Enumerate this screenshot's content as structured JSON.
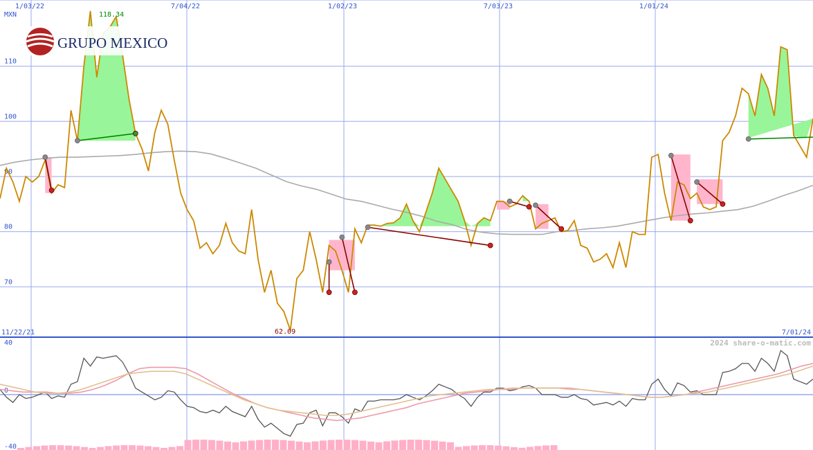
{
  "logo": {
    "text": "GRUPO MEXICO"
  },
  "watermark": "2024 share-o-matic.com",
  "chart_data": [
    {
      "type": "line",
      "title": "",
      "ylabel": "MXN",
      "x_tick_labels": [
        "1/03/22",
        "7/04/22",
        "1/02/23",
        "7/03/23",
        "1/01/24"
      ],
      "y_ticks": [
        70,
        80,
        90,
        100,
        110
      ],
      "ylim": [
        61,
        122
      ],
      "grid": true,
      "annotations": {
        "high": "118.34",
        "low": "62.09"
      },
      "series": [
        {
          "role": "price",
          "color": "#cc8800",
          "values": [
            86,
            91.5,
            89,
            85.5,
            90,
            89,
            90,
            93,
            87,
            88.5,
            88,
            102,
            96.5,
            110,
            120,
            108,
            116,
            117,
            119,
            112,
            104,
            97.8,
            95,
            91,
            98,
            102,
            99.5,
            93,
            87,
            84,
            82,
            77,
            78,
            76,
            77.5,
            81.5,
            78,
            76.5,
            76,
            84,
            75,
            69,
            73,
            67,
            65.5,
            62.09,
            71.5,
            73,
            80,
            75,
            69,
            77.5,
            76.5,
            73,
            69,
            80.5,
            78,
            81.2,
            81.2,
            81,
            81.5,
            81.6,
            82.5,
            85,
            82,
            80,
            83.5,
            87,
            91.5,
            89.5,
            87.5,
            85.5,
            82,
            77.5,
            81.5,
            82.5,
            82,
            85.5,
            85.5,
            84.5,
            85,
            86.5,
            85.5,
            80.5,
            81.5,
            82,
            82.5,
            80,
            80.2,
            82,
            77.5,
            77,
            74.5,
            75,
            76,
            73.5,
            78,
            73.5,
            80,
            79.5,
            79.5,
            93.5,
            94,
            87,
            82,
            89,
            88.5,
            86,
            87,
            84.5,
            84,
            84.5,
            96.5,
            98,
            101,
            106,
            105,
            101,
            108.5,
            106,
            101,
            113.5,
            113,
            97.5,
            95.5,
            93.5,
            100.5
          ]
        },
        {
          "role": "moving-average",
          "color": "#aaaaaa",
          "values": [
            92,
            92.6,
            93,
            93.3,
            93.5,
            93.5,
            93.6,
            93.7,
            93.8,
            94,
            94.3,
            94.5,
            94.6,
            94.5,
            94.1,
            93.3,
            92.4,
            91.5,
            90.3,
            89.1,
            88.3,
            87.7,
            86.8,
            85.9,
            85.5,
            84.8,
            84.1,
            83.5,
            82.8,
            81.9,
            81.3,
            80.4,
            79.9,
            79.6,
            79.5,
            79.5,
            79.5,
            80,
            80.2,
            80.5,
            80.7,
            81,
            81.5,
            82,
            82.5,
            82.9,
            83.2,
            83.4,
            83.7,
            84,
            84.6,
            85.5,
            86.5,
            87.4,
            88.4
          ]
        }
      ]
    },
    {
      "type": "line",
      "title": "",
      "x_tick_labels": [
        "11/22/21",
        "7/01/24"
      ],
      "y_ticks": [
        40,
        0,
        -40
      ],
      "ylim": [
        -40,
        40
      ],
      "grid": true,
      "series": [
        {
          "role": "oscillator",
          "color": "#555555",
          "values": [
            4,
            -2,
            -6,
            0,
            -3,
            -2,
            0,
            2,
            -3,
            -1,
            -2,
            8,
            10,
            28,
            22,
            29,
            28,
            29,
            30,
            25,
            16,
            5,
            2,
            -1,
            -4,
            -2,
            3,
            2,
            -4,
            -9,
            -10,
            -13,
            -14,
            -12,
            -14,
            -9,
            -13,
            -15,
            -17,
            -9,
            -19,
            -25,
            -22,
            -26,
            -30,
            -32,
            -23,
            -22,
            -14,
            -12,
            -24,
            -14,
            -14,
            -17,
            -22,
            -11,
            -13,
            -5,
            -5,
            -4,
            -4,
            -4,
            -3,
            0,
            -2,
            -4,
            -1,
            3,
            8,
            6,
            4,
            0,
            -3,
            -9,
            -2,
            2,
            2,
            5,
            5,
            3,
            4,
            6,
            7,
            5,
            0,
            0,
            0,
            -2,
            -2,
            0,
            -3,
            -4,
            -8,
            -7,
            -6,
            -8,
            -5,
            -9,
            -3,
            -4,
            -4,
            8,
            12,
            4,
            -1,
            9,
            7,
            2,
            3,
            0,
            0,
            0,
            17,
            18,
            20,
            24,
            24,
            18,
            28,
            24,
            18,
            34,
            30,
            12,
            10,
            8,
            12
          ]
        },
        {
          "role": "signal-fast",
          "color": "#ee99aa",
          "values": [
            4,
            3,
            2,
            2,
            2,
            1,
            1,
            2,
            4,
            7,
            11,
            16,
            20,
            21,
            21,
            21,
            20,
            16,
            11,
            6,
            1,
            -3,
            -7,
            -10,
            -12,
            -14,
            -16,
            -18,
            -19,
            -20,
            -19,
            -18,
            -16,
            -14,
            -12,
            -10,
            -7,
            -5,
            -3,
            -1,
            1,
            2,
            3,
            4,
            4,
            5,
            5,
            5,
            5,
            5,
            4,
            3,
            2,
            1,
            0,
            -1,
            -2,
            -2,
            -1,
            0,
            2,
            4,
            6,
            8,
            10,
            12,
            14,
            16,
            19,
            22,
            24
          ]
        },
        {
          "role": "signal-slow",
          "color": "#e0c090",
          "values": [
            8,
            6,
            4,
            2,
            1,
            1,
            2,
            4,
            7,
            10,
            13,
            16,
            17,
            18,
            18,
            18,
            16,
            12,
            8,
            4,
            0,
            -4,
            -7,
            -10,
            -12,
            -13,
            -14,
            -15,
            -16,
            -16,
            -15,
            -13,
            -11,
            -9,
            -7,
            -5,
            -3,
            -1,
            0,
            1,
            2,
            3,
            4,
            4,
            5,
            5,
            5,
            5,
            5,
            4,
            4,
            3,
            2,
            1,
            0,
            -1,
            -2,
            -2,
            -1,
            0,
            1,
            2,
            4,
            6,
            8,
            10,
            12,
            14,
            16,
            19,
            22
          ]
        }
      ],
      "bars_color": "#ffb0c8"
    }
  ]
}
